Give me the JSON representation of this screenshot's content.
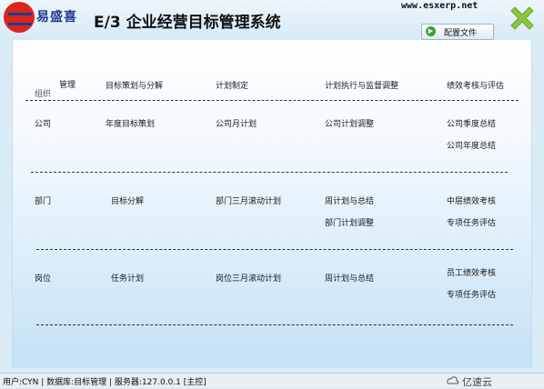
{
  "header": {
    "logo_text": "易盛喜",
    "app_title": "E/3 企业经营目标管理系统",
    "website": "www.esxerp.net",
    "config_button": "配置文件"
  },
  "table": {
    "col_headers": {
      "org_management": "管理",
      "org": "组织",
      "plan_decompose": "目标策划与分解",
      "plan_make": "计划制定",
      "plan_exec": "计划执行与监督调整",
      "perf_eval": "绩效考核与评估"
    },
    "rows": [
      {
        "org": "公司",
        "plan_decompose": "年度目标策划",
        "plan_make": "公司月计划",
        "plan_exec": [
          "公司计划调整"
        ],
        "perf_eval": [
          "公司季度总结",
          "公司年度总结"
        ]
      },
      {
        "org": "部门",
        "plan_decompose": "目标分解",
        "plan_make": "部门三月滚动计划",
        "plan_exec": [
          "周计划与总结",
          "部门计划调整"
        ],
        "perf_eval": [
          "中层绩效考核",
          "专项任务评估"
        ]
      },
      {
        "org": "岗位",
        "plan_decompose": "任务计划",
        "plan_make": "岗位三月滚动计划",
        "plan_exec": [
          "周计划与总结"
        ],
        "perf_eval": [
          "员工绩效考核",
          "专项任务评估"
        ]
      }
    ]
  },
  "statusbar": {
    "text": "用户:CYN | 数据库:目标管理 | 服务器:127.0.0.1 [主控]",
    "watermark": "亿速云"
  },
  "colors": {
    "logo_red": "#d8261d",
    "logo_blue": "#1f3e8a",
    "close_green": "#8cc63f",
    "config_icon_green": "#3da033"
  }
}
